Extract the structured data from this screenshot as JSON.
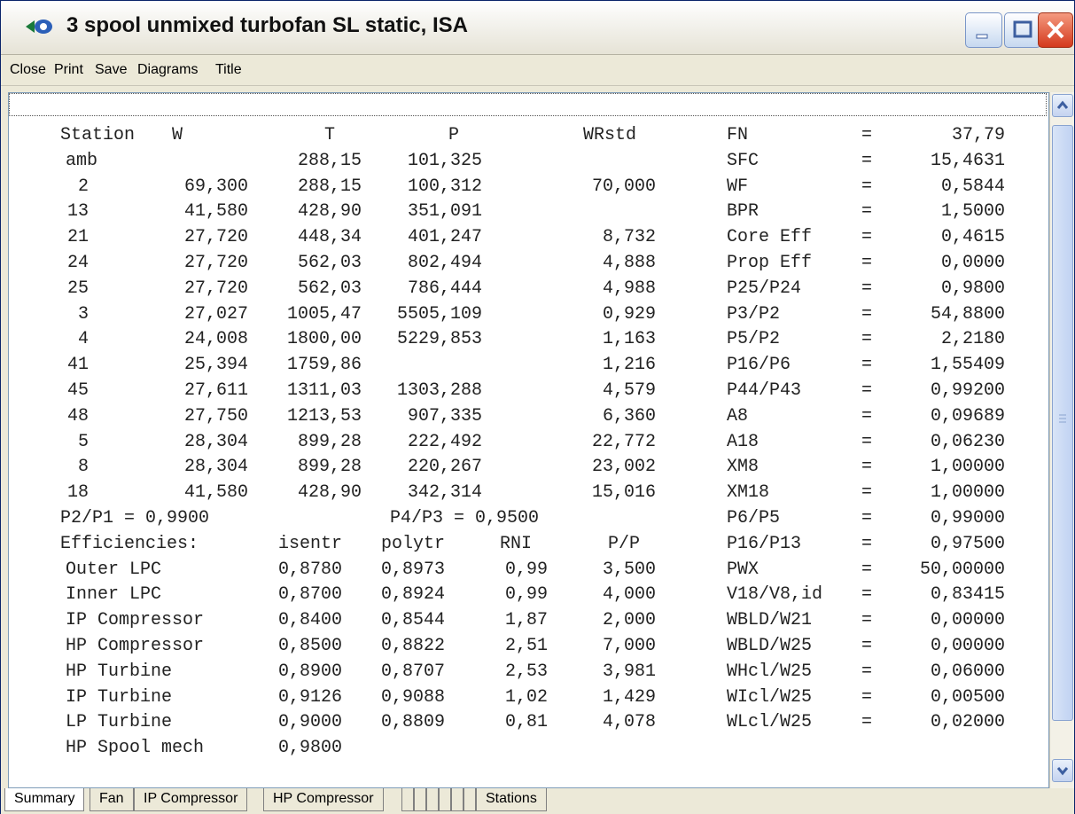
{
  "window": {
    "title": "3 spool unmixed turbofan SL static, ISA"
  },
  "menu": [
    "Close",
    "Print",
    "Save",
    "Diagrams",
    "Title"
  ],
  "stations": {
    "headers": [
      "Station",
      "W",
      "T",
      "P",
      "WRstd"
    ],
    "rows": [
      [
        "amb",
        "",
        "288,15",
        "101,325",
        ""
      ],
      [
        "2",
        "69,300",
        "288,15",
        "100,312",
        "70,000"
      ],
      [
        "13",
        "41,580",
        "428,90",
        "351,091",
        ""
      ],
      [
        "21",
        "27,720",
        "448,34",
        "401,247",
        "8,732"
      ],
      [
        "24",
        "27,720",
        "562,03",
        "802,494",
        "4,888"
      ],
      [
        "25",
        "27,720",
        "562,03",
        "786,444",
        "4,988"
      ],
      [
        "3",
        "27,027",
        "1005,47",
        "5505,109",
        "0,929"
      ],
      [
        "4",
        "24,008",
        "1800,00",
        "5229,853",
        "1,163"
      ],
      [
        "41",
        "25,394",
        "1759,86",
        "",
        "1,216"
      ],
      [
        "45",
        "27,611",
        "1311,03",
        "1303,288",
        "4,579"
      ],
      [
        "48",
        "27,750",
        "1213,53",
        "907,335",
        "6,360"
      ],
      [
        "5",
        "28,304",
        "899,28",
        "222,492",
        "22,772"
      ],
      [
        "8",
        "28,304",
        "899,28",
        "220,267",
        "23,002"
      ],
      [
        "18",
        "41,580",
        "428,90",
        "342,314",
        "15,016"
      ]
    ]
  },
  "ratios": {
    "p2p1": "P2/P1 = 0,9900",
    "p4p3": "P4/P3 = 0,9500"
  },
  "efficiencies": {
    "title": "Efficiencies:",
    "headers": [
      "isentr",
      "polytr",
      "RNI",
      "P/P"
    ],
    "rows": [
      [
        "Outer LPC",
        "0,8780",
        "0,8973",
        "0,99",
        "3,500"
      ],
      [
        "Inner LPC",
        "0,8700",
        "0,8924",
        "0,99",
        "4,000"
      ],
      [
        "IP Compressor",
        "0,8400",
        "0,8544",
        "1,87",
        "2,000"
      ],
      [
        "HP Compressor",
        "0,8500",
        "0,8822",
        "2,51",
        "7,000"
      ],
      [
        "HP Turbine",
        "0,8900",
        "0,8707",
        "2,53",
        "3,981"
      ],
      [
        "IP Turbine",
        "0,9126",
        "0,9088",
        "1,02",
        "1,429"
      ],
      [
        "LP Turbine",
        "0,9000",
        "0,8809",
        "0,81",
        "4,078"
      ],
      [
        "HP Spool mech",
        "0,9800",
        "",
        "",
        ""
      ]
    ]
  },
  "summary": [
    [
      "FN",
      "=",
      "37,79"
    ],
    [
      "SFC",
      "=",
      "15,4631"
    ],
    [
      "WF",
      "=",
      "0,5844"
    ],
    [
      "BPR",
      "=",
      "1,5000"
    ],
    [
      "Core Eff",
      "=",
      "0,4615"
    ],
    [
      "Prop Eff",
      "=",
      "0,0000"
    ],
    [
      "P25/P24",
      "=",
      "0,9800"
    ],
    [
      "P3/P2",
      "=",
      "54,8800"
    ],
    [
      "P5/P2",
      "=",
      "2,2180"
    ],
    [
      "P16/P6",
      "=",
      "1,55409"
    ],
    [
      "P44/P43",
      "=",
      "0,99200"
    ],
    [
      "A8",
      "=",
      "0,09689"
    ],
    [
      "A18",
      "=",
      "0,06230"
    ],
    [
      "XM8",
      "=",
      "1,00000"
    ],
    [
      "XM18",
      "=",
      "1,00000"
    ],
    [
      "P6/P5",
      "=",
      "0,99000"
    ],
    [
      "P16/P13",
      "=",
      "0,97500"
    ],
    [
      "PWX",
      "=",
      "50,00000"
    ],
    [
      "V18/V8,id",
      "=",
      "0,83415"
    ],
    [
      "WBLD/W21",
      "=",
      "0,00000"
    ],
    [
      "WBLD/W25",
      "=",
      "0,00000"
    ],
    [
      "WHcl/W25",
      "=",
      "0,06000"
    ],
    [
      "WIcl/W25",
      "=",
      "0,00500"
    ],
    [
      "WLcl/W25",
      "=",
      "0,02000"
    ]
  ],
  "tabs": [
    "Summary",
    "Fan",
    "IP Compressor",
    "HP Compressor",
    "Stations"
  ]
}
